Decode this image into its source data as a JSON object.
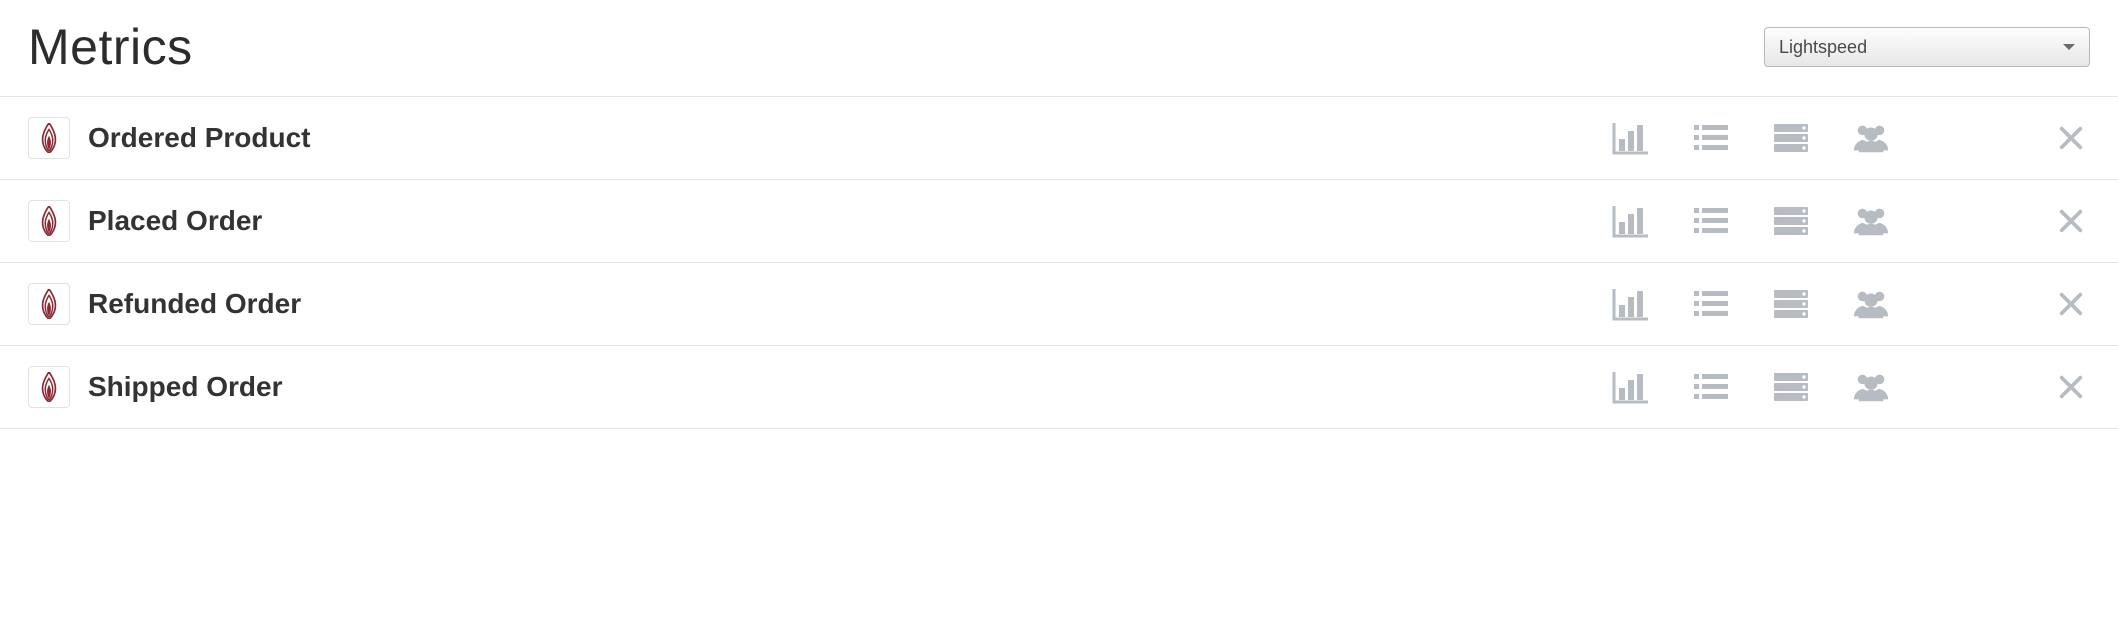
{
  "header": {
    "title": "Metrics",
    "filter_selected": "Lightspeed"
  },
  "icons": {
    "integration_name": "lightspeed-icon"
  },
  "metrics": [
    {
      "name": "Ordered Product"
    },
    {
      "name": "Placed Order"
    },
    {
      "name": "Refunded Order"
    },
    {
      "name": "Shipped Order"
    }
  ],
  "action_labels": {
    "chart": "chart",
    "list": "activity-feed",
    "segment": "cohorts",
    "people": "people",
    "delete": "delete"
  }
}
